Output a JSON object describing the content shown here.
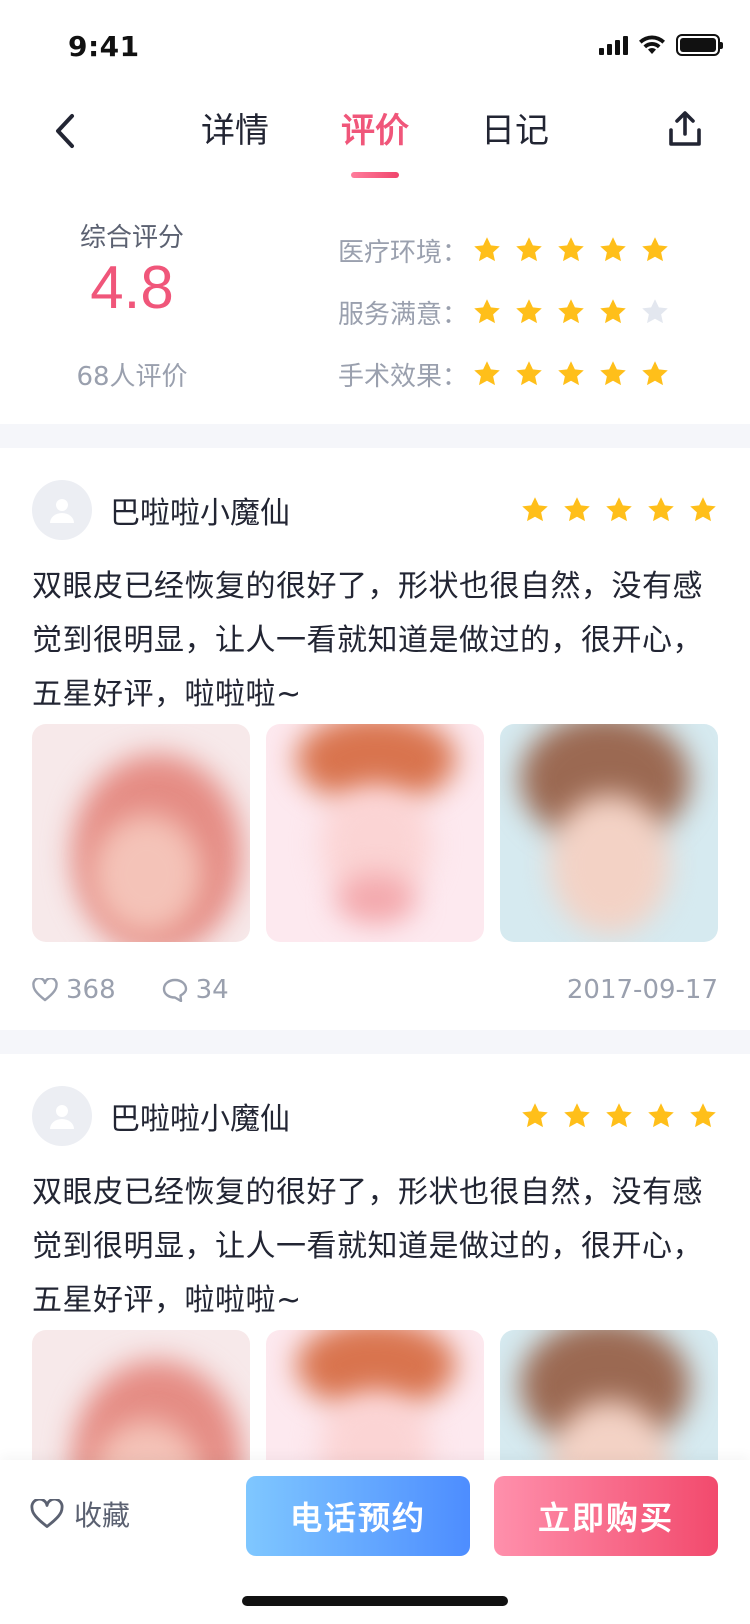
{
  "status_bar": {
    "time": "9:41"
  },
  "nav": {
    "tabs": [
      {
        "label": "详情",
        "active": false
      },
      {
        "label": "评价",
        "active": true
      },
      {
        "label": "日记",
        "active": false
      }
    ]
  },
  "summary": {
    "overall_label": "综合评分",
    "overall_score": "4.8",
    "review_count": "68人评价",
    "categories": [
      {
        "label": "医疗环境：",
        "rating": 5
      },
      {
        "label": "服务满意：",
        "rating": 4
      },
      {
        "label": "手术效果：",
        "rating": 5
      }
    ]
  },
  "reviews": [
    {
      "username": "巴啦啦小魔仙",
      "rating": 5,
      "text": "双眼皮已经恢复的很好了，形状也很自然，没有感觉到很明显，让人一看就知道是做过的，很开心，五星好评，啦啦啦~",
      "likes": "368",
      "comments": "34",
      "date": "2017-09-17"
    },
    {
      "username": "巴啦啦小魔仙",
      "rating": 5,
      "text": "双眼皮已经恢复的很好了，形状也很自然，没有感觉到很明显，让人一看就知道是做过的，很开心，五星好评，啦啦啦~"
    }
  ],
  "bottom_bar": {
    "favorite_label": "收藏",
    "phone_button": "电话预约",
    "buy_button": "立即购买"
  },
  "colors": {
    "accent_pink": "#f0567a",
    "star_gold": "#ffbf1a",
    "star_empty": "#e3e7ef",
    "phone_blue": "#4d8dff"
  }
}
